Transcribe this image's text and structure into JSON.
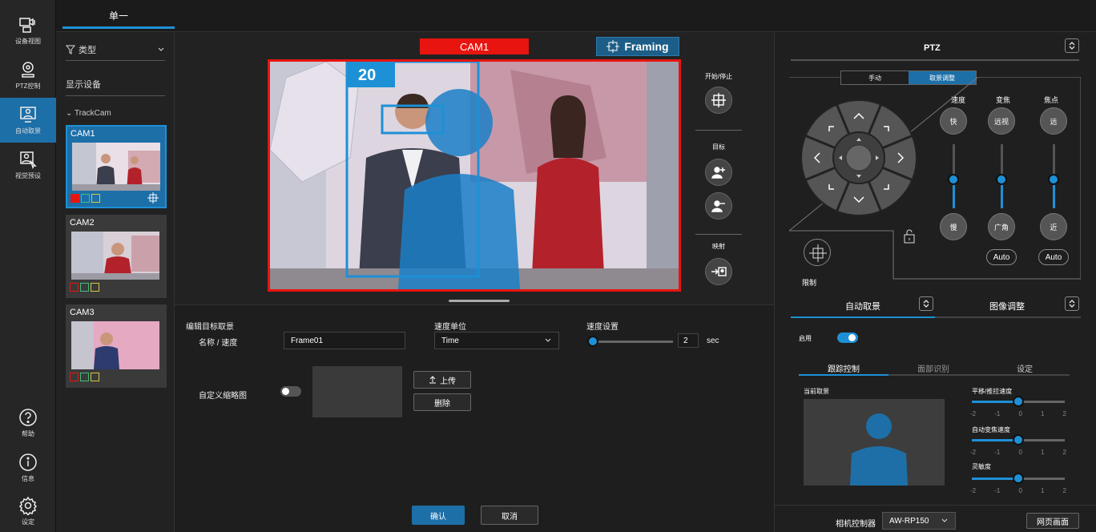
{
  "rail": {
    "items": [
      {
        "label": "设备视图",
        "icon": "device-view-icon"
      },
      {
        "label": "PTZ控制",
        "icon": "ptz-control-icon"
      },
      {
        "label": "自动取景",
        "icon": "auto-framing-icon"
      },
      {
        "label": "视觉预设",
        "icon": "visual-preset-icon"
      },
      {
        "label": "帮助",
        "icon": "help-icon"
      },
      {
        "label": "信息",
        "icon": "info-icon"
      },
      {
        "label": "设定",
        "icon": "settings-icon"
      }
    ],
    "active_index": 2
  },
  "top_tab": "单一",
  "camlist": {
    "type_label": "类型",
    "show_devices": "显示设备",
    "group": "TrackCam",
    "cams": [
      {
        "name": "CAM1",
        "selected": true
      },
      {
        "name": "CAM2",
        "selected": false
      },
      {
        "name": "CAM3",
        "selected": false
      }
    ]
  },
  "view": {
    "cam_label": "CAM1",
    "framing_label": "Framing",
    "target_number": "20",
    "start_stop": "开始/停止",
    "target": "目标",
    "mapping": "映射"
  },
  "edit": {
    "title": "编辑目标取景",
    "name_speed_label": "名称 / 速度",
    "name_value": "Frame01",
    "speed_unit_label": "速度单位",
    "speed_unit_value": "Time",
    "speed_setting_label": "速度设置",
    "speed_value": "2",
    "speed_unit_suffix": "sec",
    "custom_thumb_label": "自定义缩略图",
    "upload": "上传",
    "delete": "删除",
    "ok": "确认",
    "cancel": "取消"
  },
  "ptz": {
    "title": "PTZ",
    "mode_tabs": [
      "手动",
      "取景调整"
    ],
    "active_mode": 1,
    "speed": "速度",
    "zoom": "变焦",
    "focus": "焦点",
    "fast": "快",
    "slow": "慢",
    "tele": "远视",
    "wide": "广角",
    "far": "远",
    "near": "近",
    "auto1": "Auto",
    "auto2": "Auto",
    "limit": "限制",
    "speed_level": 0.45,
    "zoom_level": 0.45,
    "focus_level": 0.45
  },
  "af": {
    "tab_auto": "自动取景",
    "tab_image": "图像调整",
    "enable_label": "启用",
    "enabled": true,
    "subtabs": [
      "跟踪控制",
      "面部识别",
      "设定"
    ],
    "active_subtab": 0,
    "current_framing": "当前取景",
    "sliders": [
      {
        "label": "平移/推拉速度",
        "value": 0
      },
      {
        "label": "自动变焦速度",
        "value": 0
      },
      {
        "label": "灵敏度",
        "value": 0
      }
    ],
    "ticks": [
      "-2",
      "-1",
      "0",
      "1",
      "2"
    ]
  },
  "footer": {
    "controller_label": "相机控制器",
    "controller_value": "AW-RP150",
    "web_button": "网页画面"
  },
  "colors": {
    "accent": "#1e90d6",
    "tally": "#e8140f"
  }
}
